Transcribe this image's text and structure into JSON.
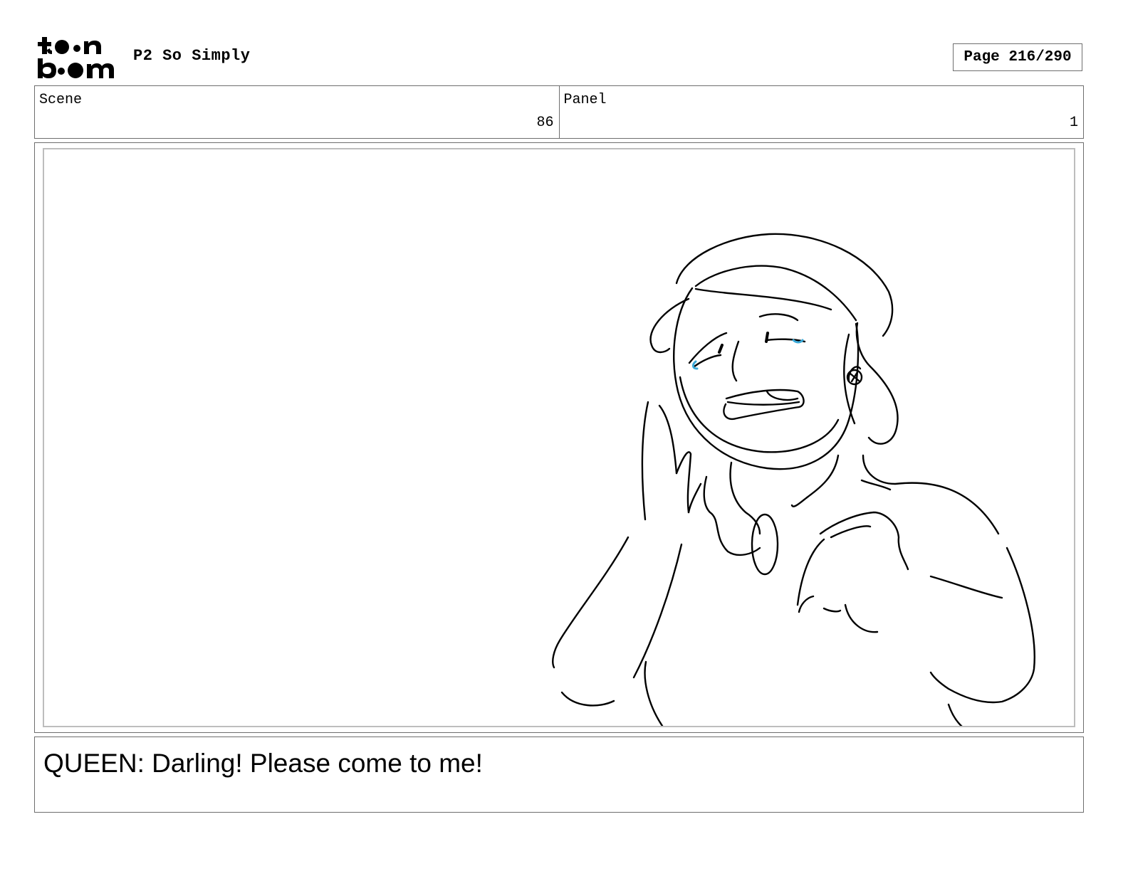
{
  "header": {
    "logo_text": "toonboom",
    "project_title": "P2 So Simply",
    "page_label": "Page 216/290"
  },
  "info": {
    "scene_label": "Scene",
    "scene_value": "86",
    "panel_label": "Panel",
    "panel_value": "1"
  },
  "panel": {
    "drawing_name": "crying-queen-sketch",
    "tear_color": "#3aa9d8"
  },
  "dialogue": {
    "text": "QUEEN: Darling! Please come to me!"
  }
}
